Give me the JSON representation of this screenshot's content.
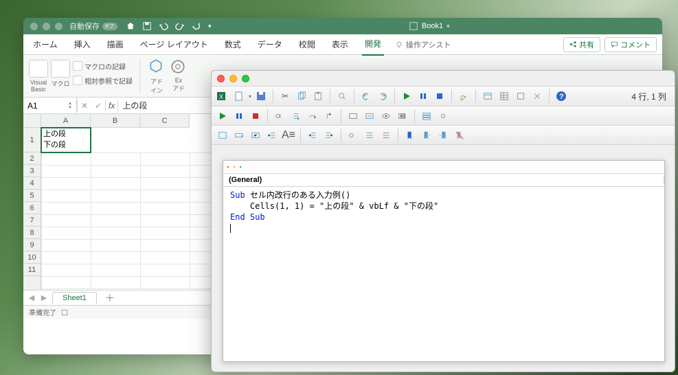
{
  "titlebar": {
    "autosave_label": "自動保存",
    "book_title": "Book1"
  },
  "ribbon": {
    "tabs": [
      "ホーム",
      "挿入",
      "描画",
      "ページ レイアウト",
      "数式",
      "データ",
      "校閲",
      "表示",
      "開発"
    ],
    "active_index": 8,
    "assist": "操作アシスト",
    "share": "共有",
    "comment": "コメント"
  },
  "ribbon_body": {
    "vb": "Visual\nBasic",
    "macro": "マクロ",
    "record_macro": "マクロの記録",
    "relative_ref": "相対参照で記録",
    "addin": "アド\nイン",
    "exceladdin": "Ex\nアド"
  },
  "formula": {
    "name": "A1",
    "fx": "fx",
    "value": "上の段"
  },
  "sheet": {
    "cols": [
      "A",
      "B",
      "C"
    ],
    "rows": [
      "1",
      "2",
      "3",
      "4",
      "5",
      "6",
      "7",
      "8",
      "9",
      "10",
      "11"
    ],
    "a1_line1": "上の段",
    "a1_line2": "下の段"
  },
  "tabs": {
    "sheet1": "Sheet1"
  },
  "status": {
    "ready": "準備完了"
  },
  "vbe": {
    "status": "4 行, 1 列",
    "obj": "(General)",
    "code": {
      "l1a": "Sub",
      "l1b": " セル内改行のある入力例()",
      "l2": "    Cells(1, 1) = \"上の段\" & vbLf & \"下の段\"",
      "l3": "End Sub"
    }
  },
  "chart_data": null
}
